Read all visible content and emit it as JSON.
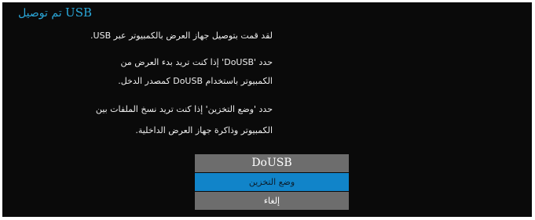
{
  "dialog": {
    "title_usb": "USB",
    "title_text": "تم توصيل",
    "message1": "لقد قمت بتوصيل جهاز العرض بالكمبيوتر عبر USB.",
    "message2_line1": "حدد 'DoUSB' إذا كنت تريد بدء العرض من",
    "message2_line2": "الكمبيوتر باستخدام DoUSB كمصدر الدخل.",
    "message3_line1": "حدد 'وضع التخزين' إذا كنت تريد نسخ الملفات بين",
    "message3_line2": "الكمبيوتر وذاكرة جهاز العرض الداخلية."
  },
  "menu": {
    "header": "DoUSB",
    "storage_mode": "وضع التخزين",
    "cancel": "إلغاء"
  },
  "colors": {
    "accent": "#2aa7d9",
    "selected": "#1184c9",
    "item_bg": "#6d6d6d",
    "background": "#0a0a0a"
  }
}
